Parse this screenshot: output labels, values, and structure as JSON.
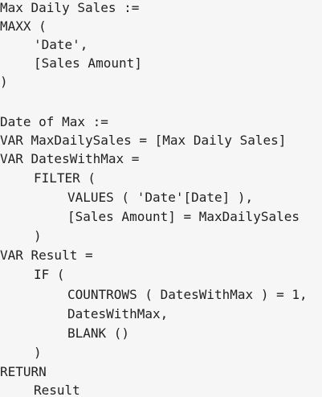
{
  "code": {
    "lines": [
      "Max Daily Sales :=",
      "MAXX (",
      "'Date',",
      "[Sales Amount]",
      ")",
      "",
      "Date of Max :=",
      "VAR MaxDailySales = [Max Daily Sales]",
      "VAR DatesWithMax =",
      "FILTER (",
      "VALUES ( 'Date'[Date] ),",
      "[Sales Amount] = MaxDailySales",
      ")",
      "VAR Result =",
      "IF (",
      "COUNTROWS ( DatesWithMax ) = 1,",
      "DatesWithMax,",
      "BLANK ()",
      ")",
      "RETURN",
      "Result"
    ]
  }
}
